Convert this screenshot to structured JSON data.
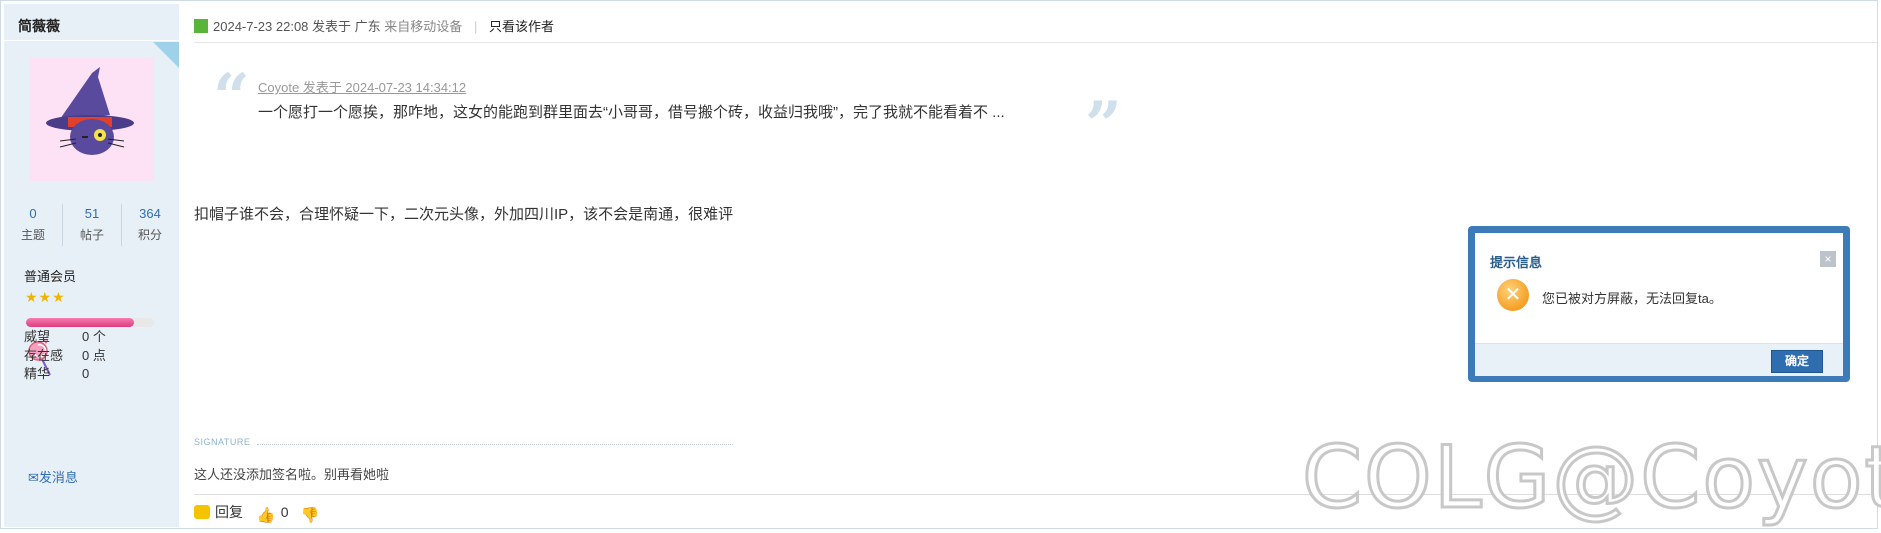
{
  "user": {
    "name": "简薇薇",
    "stats": [
      {
        "value": "0",
        "label": "主题"
      },
      {
        "value": "51",
        "label": "帖子"
      },
      {
        "value": "364",
        "label": "积分"
      }
    ],
    "rank": "普通会员",
    "stars": "★★★",
    "level_progress": 0.84,
    "info": [
      {
        "key": "威望",
        "value": "0 个"
      },
      {
        "key": "存在感",
        "value": "0 点"
      },
      {
        "key": "精华",
        "value": "0"
      }
    ],
    "pm_label": "发消息"
  },
  "post": {
    "datetime": "2024-7-23 22:08",
    "posted_in": "发表于 广东",
    "device": "来自移动设备",
    "only_author": "只看该作者",
    "quote_header": "Coyote 发表于 2024-07-23 14:34:12",
    "quote_body": "一个愿打一个愿挨，那咋地，这女的能跑到群里面去“小哥哥，借号搬个砖，收益归我哦”，完了我就不能看着不 ...",
    "body": "扣帽子谁不会，合理怀疑一下，二次元头像，外加四川IP，该不会是南通，很难评",
    "signature_label": "SIGNATURE",
    "signature": "这人还没添加签名啦。别再看她啦",
    "reply_label": "回复",
    "like_count": "0"
  },
  "dialog": {
    "title": "提示信息",
    "close": "×",
    "message": "您已被对方屏蔽，无法回复ta。",
    "ok": "确定"
  },
  "watermark": "COLG@Coyote"
}
